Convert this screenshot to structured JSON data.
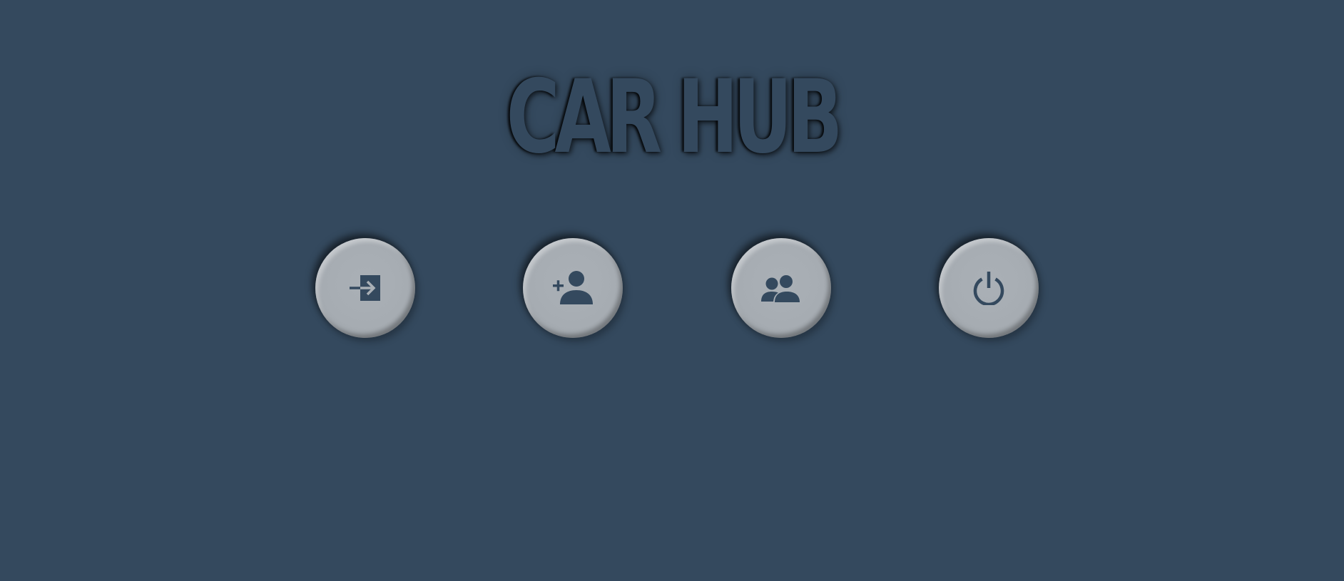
{
  "header": {
    "title": "CAR HUB"
  },
  "colors": {
    "background": "#34495e",
    "button_face": "#a9afb5",
    "icon": "#34495e"
  },
  "buttons": [
    {
      "icon": "sign-in-icon"
    },
    {
      "icon": "add-user-icon"
    },
    {
      "icon": "users-icon"
    },
    {
      "icon": "power-icon"
    }
  ]
}
